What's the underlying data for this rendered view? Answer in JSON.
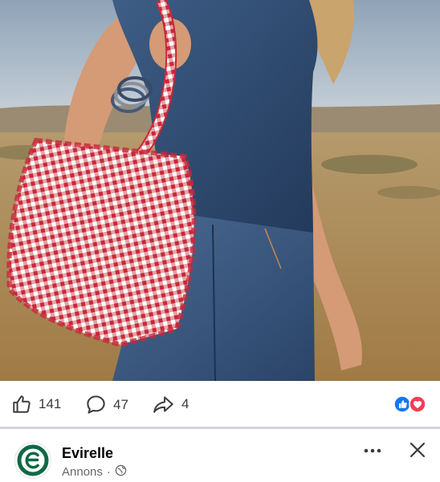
{
  "post": {
    "image_alt": "Woman in denim top and jeans carrying a red gingham ruffled tote bag in a grass field",
    "icon": "photo"
  },
  "actions": {
    "like_count": "141",
    "comment_count": "47",
    "share_count": "4",
    "like_icon": "thumbs-up-icon",
    "comment_icon": "comment-bubble-icon",
    "share_icon": "share-arrow-icon",
    "reactions": [
      "like",
      "love"
    ]
  },
  "author": {
    "name": "Evirelle",
    "sponsored_label": "Annons",
    "separator": "·",
    "privacy_icon": "globe-icon",
    "brand_color": "#0f6a44"
  },
  "colors": {
    "like_blue": "#1877f2",
    "love_red": "#f33e58",
    "text_secondary": "#65676b"
  }
}
